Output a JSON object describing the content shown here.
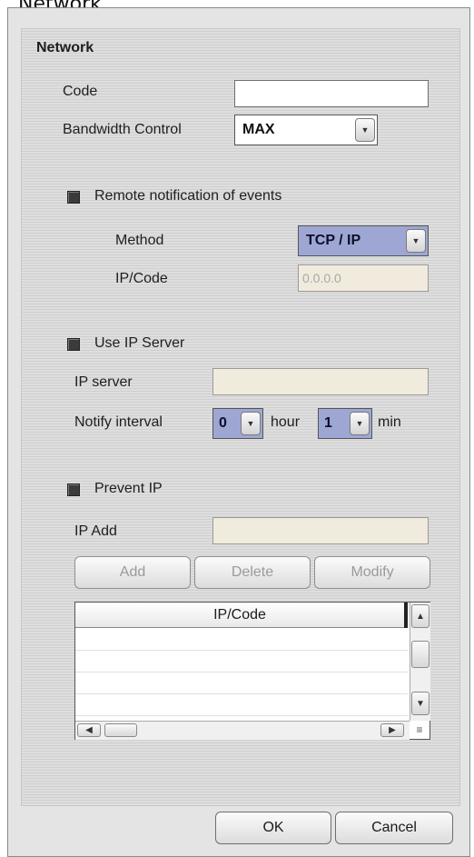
{
  "window": {
    "title": "Network"
  },
  "panel": {
    "heading": "Network",
    "code": {
      "label": "Code",
      "value": ""
    },
    "bandwidth": {
      "label": "Bandwidth Control",
      "value": "MAX"
    },
    "remote": {
      "checkbox_label": "Remote notification of events",
      "checked": true,
      "method": {
        "label": "Method",
        "value": "TCP / IP"
      },
      "ip_code": {
        "label": "IP/Code",
        "value": "0.0.0.0"
      }
    },
    "ip_server": {
      "checkbox_label": "Use IP Server",
      "checked": true,
      "server": {
        "label": "IP server",
        "value": ""
      },
      "notify": {
        "label": "Notify interval",
        "hour_value": "0",
        "hour_unit": "hour",
        "min_value": "1",
        "min_unit": "min"
      }
    },
    "prevent": {
      "checkbox_label": "Prevent IP",
      "checked": true,
      "ip_add": {
        "label": "IP Add",
        "value": ""
      },
      "buttons": {
        "add": "Add",
        "delete": "Delete",
        "modify": "Modify"
      },
      "table": {
        "column": "IP/Code"
      }
    }
  },
  "footer": {
    "ok": "OK",
    "cancel": "Cancel"
  },
  "icons": {
    "dropdown": "chevron-down-icon",
    "scroll_up": "chevron-up-icon",
    "scroll_down": "chevron-down-icon",
    "scroll_left": "chevron-left-icon",
    "scroll_right": "chevron-right-icon",
    "corner": "resize-grip-icon"
  },
  "colors": {
    "blue_combo": "#9ea7d3",
    "beige_field": "#f0ebdd",
    "panel": "#d9d9d9"
  }
}
